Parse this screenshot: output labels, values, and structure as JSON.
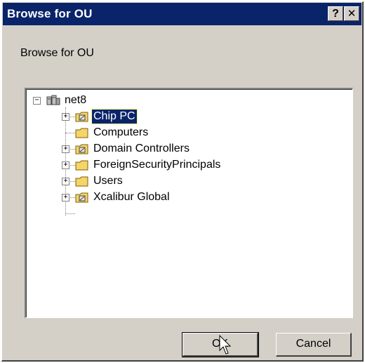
{
  "window": {
    "title": "Browse for OU",
    "help_glyph": "?",
    "close_glyph": "✕"
  },
  "prompt": "Browse for OU",
  "tree": {
    "root": {
      "label": "net8",
      "expander": "−",
      "icon": "domain-icon"
    },
    "items": [
      {
        "label": "Chip PC",
        "expander": "+",
        "icon": "ou-folder-icon",
        "selected": true
      },
      {
        "label": "Computers",
        "expander": "",
        "icon": "folder-icon",
        "selected": false
      },
      {
        "label": "Domain Controllers",
        "expander": "+",
        "icon": "ou-folder-icon",
        "selected": false
      },
      {
        "label": "ForeignSecurityPrincipals",
        "expander": "+",
        "icon": "folder-icon",
        "selected": false
      },
      {
        "label": "Users",
        "expander": "+",
        "icon": "folder-icon",
        "selected": false
      },
      {
        "label": "Xcalibur Global",
        "expander": "+",
        "icon": "ou-folder-icon",
        "selected": false
      }
    ]
  },
  "buttons": {
    "ok": "OK",
    "cancel": "Cancel"
  },
  "colors": {
    "titlebar": "#0a246a",
    "selection": "#0a246a",
    "folder": "#f5d46a",
    "face": "#d4d0c8"
  }
}
